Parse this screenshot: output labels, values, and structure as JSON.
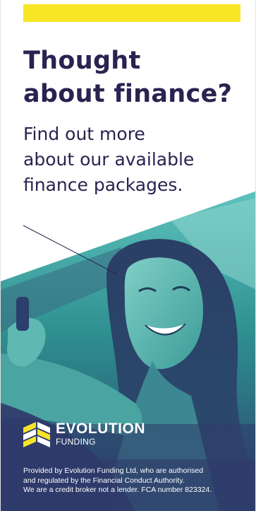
{
  "brand": {
    "accent_yellow": "#f7e526",
    "headline_color": "#2b2250",
    "overlay_color": "#2f3a6a",
    "photo_tint": "#2e9a98"
  },
  "headline": {
    "line1": "Thought",
    "line2": "about finance?"
  },
  "subhead": {
    "line1": "Find out more",
    "line2": "about our available",
    "line3": "finance packages."
  },
  "photo": {
    "icon": "smiling-woman-in-car-photo"
  },
  "logo": {
    "icon": "evolution-funding-logo-mark",
    "word1": "EVOLUTION",
    "word2": "FUNDING"
  },
  "disclaimer": {
    "line1": "Provided by Evolution Funding Ltd, who are authorised",
    "line2": "and regulated by the Financial Conduct Authority.",
    "line3": "We are a credit broker not a lender. FCA number 823324."
  }
}
